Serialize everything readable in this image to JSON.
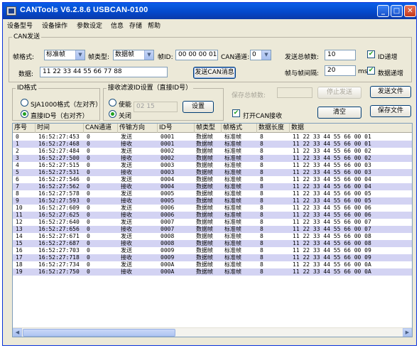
{
  "window": {
    "title": "CANTools V6.2.8.6  USBCAN-0100",
    "min_glyph": "_",
    "max_glyph": "□",
    "close_glyph": "✕"
  },
  "menu": [
    "设备型号",
    "设备操作",
    "参数设定",
    "信息",
    "存储",
    "帮助"
  ],
  "can_send": {
    "group_label": "CAN发送",
    "frame_format_label": "帧格式:",
    "frame_format_value": "标准帧",
    "frame_type_label": "帧类型:",
    "frame_type_value": "数据帧",
    "frame_id_label": "帧ID:",
    "frame_id_value": "00 00 00 01",
    "channel_label": "CAN通道:",
    "channel_value": "0",
    "data_label": "数据:",
    "data_value": "11 22 33 44 55 66 77 88",
    "send_button": "发送CAN消息",
    "total_frames_label": "发送总帧数:",
    "total_frames_value": "10",
    "id_increment_label": "ID递增",
    "id_increment_checked": true,
    "interval_label": "帧与帧间隔:",
    "interval_value": "20",
    "interval_unit": "ms",
    "data_increment_label": "数据递增",
    "data_increment_checked": true
  },
  "id_format": {
    "group_label": "ID格式",
    "option_sja1000": "SJA1000格式（左对齐）",
    "option_direct": "直接ID号（右对齐）",
    "selected": "direct"
  },
  "rx_filter": {
    "group_label": "接收滤波ID设置（直接ID号）",
    "enable_label": "使能",
    "disable_label": "关闭",
    "selected": "disable",
    "id_value": "02 15",
    "set_button": "设置"
  },
  "right_panel": {
    "saved_frames_label": "保存总帧数:",
    "saved_frames_value": "",
    "stop_send_button": "停止发送",
    "send_file_button": "发送文件",
    "open_rx_label": "打开CAN接收",
    "open_rx_checked": true,
    "clear_button": "清空",
    "save_file_button": "保存文件"
  },
  "table": {
    "columns": [
      "序号",
      "时间",
      "CAN通道",
      "传输方向",
      "ID号",
      "帧类型",
      "帧格式",
      "数据长度",
      "数据"
    ],
    "rows": [
      [
        "0",
        "16:52:27:453",
        "0",
        "发送",
        "0001",
        "数据帧",
        "标准帧",
        "8",
        "11 22 33 44 55 66 00 01"
      ],
      [
        "1",
        "16:52:27:468",
        "0",
        "接收",
        "0001",
        "数据帧",
        "标准帧",
        "8",
        "11 22 33 44 55 66 00 01"
      ],
      [
        "2",
        "16:52:27:484",
        "0",
        "发送",
        "0002",
        "数据帧",
        "标准帧",
        "8",
        "11 22 33 44 55 66 00 02"
      ],
      [
        "3",
        "16:52:27:500",
        "0",
        "接收",
        "0002",
        "数据帧",
        "标准帧",
        "8",
        "11 22 33 44 55 66 00 02"
      ],
      [
        "4",
        "16:52:27:515",
        "0",
        "发送",
        "0003",
        "数据帧",
        "标准帧",
        "8",
        "11 22 33 44 55 66 00 03"
      ],
      [
        "5",
        "16:52:27:531",
        "0",
        "接收",
        "0003",
        "数据帧",
        "标准帧",
        "8",
        "11 22 33 44 55 66 00 03"
      ],
      [
        "6",
        "16:52:27:546",
        "0",
        "发送",
        "0004",
        "数据帧",
        "标准帧",
        "8",
        "11 22 33 44 55 66 00 04"
      ],
      [
        "7",
        "16:52:27:562",
        "0",
        "接收",
        "0004",
        "数据帧",
        "标准帧",
        "8",
        "11 22 33 44 55 66 00 04"
      ],
      [
        "8",
        "16:52:27:578",
        "0",
        "发送",
        "0005",
        "数据帧",
        "标准帧",
        "8",
        "11 22 33 44 55 66 00 05"
      ],
      [
        "9",
        "16:52:27:593",
        "0",
        "接收",
        "0005",
        "数据帧",
        "标准帧",
        "8",
        "11 22 33 44 55 66 00 05"
      ],
      [
        "10",
        "16:52:27:609",
        "0",
        "发送",
        "0006",
        "数据帧",
        "标准帧",
        "8",
        "11 22 33 44 55 66 00 06"
      ],
      [
        "11",
        "16:52:27:625",
        "0",
        "接收",
        "0006",
        "数据帧",
        "标准帧",
        "8",
        "11 22 33 44 55 66 00 06"
      ],
      [
        "12",
        "16:52:27:640",
        "0",
        "发送",
        "0007",
        "数据帧",
        "标准帧",
        "8",
        "11 22 33 44 55 66 00 07"
      ],
      [
        "13",
        "16:52:27:656",
        "0",
        "接收",
        "0007",
        "数据帧",
        "标准帧",
        "8",
        "11 22 33 44 55 66 00 07"
      ],
      [
        "14",
        "16:52:27:671",
        "0",
        "发送",
        "0008",
        "数据帧",
        "标准帧",
        "8",
        "11 22 33 44 55 66 00 08"
      ],
      [
        "15",
        "16:52:27:687",
        "0",
        "接收",
        "0008",
        "数据帧",
        "标准帧",
        "8",
        "11 22 33 44 55 66 00 08"
      ],
      [
        "16",
        "16:52:27:703",
        "0",
        "发送",
        "0009",
        "数据帧",
        "标准帧",
        "8",
        "11 22 33 44 55 66 00 09"
      ],
      [
        "17",
        "16:52:27:718",
        "0",
        "接收",
        "0009",
        "数据帧",
        "标准帧",
        "8",
        "11 22 33 44 55 66 00 09"
      ],
      [
        "18",
        "16:52:27:734",
        "0",
        "发送",
        "000A",
        "数据帧",
        "标准帧",
        "8",
        "11 22 33 44 55 66 00 0A"
      ],
      [
        "19",
        "16:52:27:750",
        "0",
        "接收",
        "000A",
        "数据帧",
        "标准帧",
        "8",
        "11 22 33 44 55 66 00 0A"
      ]
    ]
  },
  "colors": {
    "title_bar": "#0447c9",
    "row_white": "#ffffff",
    "row_alt": "#d3d3f3",
    "checkmark": "#21a121",
    "dialog_bg": "#ece9d8"
  }
}
